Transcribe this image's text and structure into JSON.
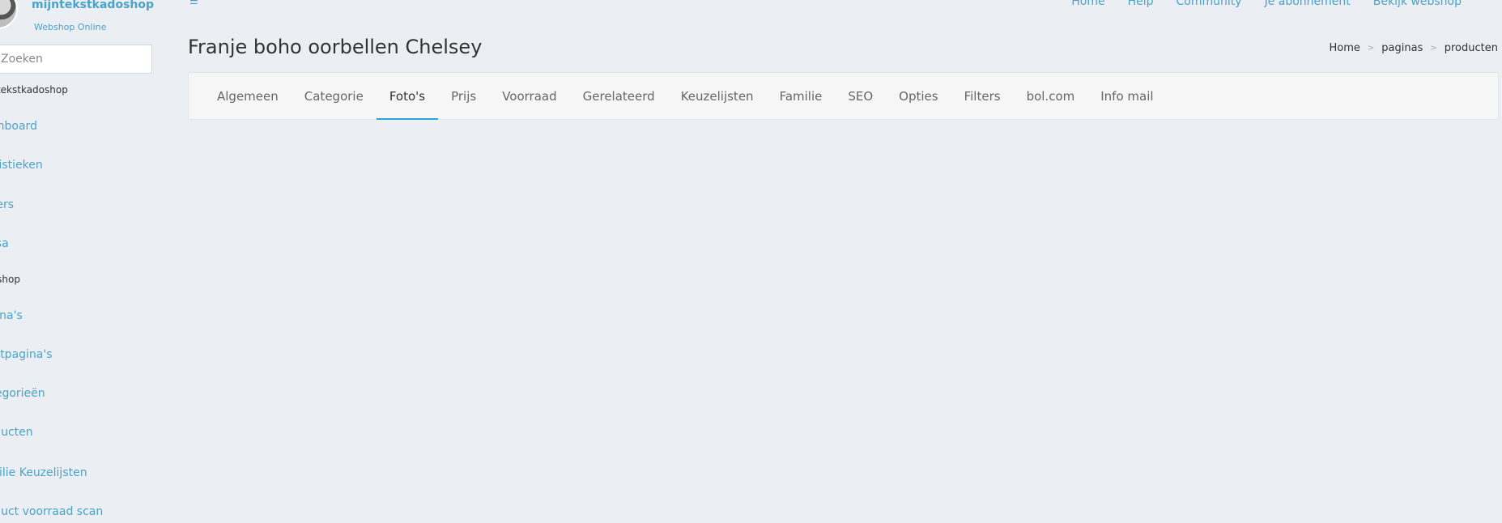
{
  "sidebar": {
    "shop_name": "mijntekstkadoshop",
    "shop_status": "Webshop Online",
    "search_placeholder": "Zoeken",
    "items": [
      {
        "label": "mijntekstkadoshop",
        "type": "small"
      },
      {
        "label": "Dashboard",
        "type": "link"
      },
      {
        "label": "Statistieken",
        "type": "link"
      },
      {
        "label": "Orders",
        "type": "link"
      },
      {
        "label": "Kassa",
        "type": "link"
      },
      {
        "label": "Webshop",
        "type": "small"
      },
      {
        "label": "Pagina's",
        "type": "link"
      },
      {
        "label": "Tekstpagina's",
        "type": "link"
      },
      {
        "label": "Categorieën",
        "type": "link"
      },
      {
        "label": "Producten",
        "type": "link"
      },
      {
        "label": "Familie Keuzelijsten",
        "type": "link"
      },
      {
        "label": "Product voorraad scan",
        "type": "link"
      }
    ]
  },
  "topnav": {
    "menu_icon": "menu-icon",
    "links": [
      "Home",
      "Help",
      "Community",
      "Je abonnement",
      "Bekijk webshop"
    ]
  },
  "header": {
    "title": "Franje boho oorbellen Chelsey",
    "breadcrumb": [
      "Home",
      "paginas",
      "producten"
    ]
  },
  "tabs": {
    "active": "Foto's",
    "items": [
      "Algemeen",
      "Categorie",
      "Foto's",
      "Prijs",
      "Voorraad",
      "Gerelateerd",
      "Keuzelijsten",
      "Familie",
      "SEO",
      "Opties",
      "Filters",
      "bol.com",
      "Info mail"
    ]
  },
  "colors": {
    "accent": "#4aa3c8",
    "tab_indicator": "#2aa6d6",
    "background": "#ebeef3"
  }
}
